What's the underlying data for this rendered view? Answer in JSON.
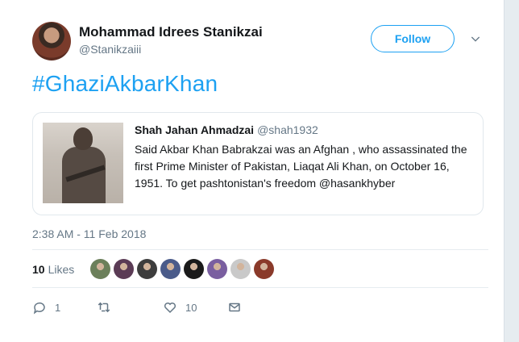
{
  "tweet": {
    "author_name": "Mohammad Idrees Stanikzai",
    "author_handle": "@Stanikzaiii",
    "follow_label": "Follow",
    "text": "#GhaziAkbarKhan",
    "timestamp": "2:38 AM - 11 Feb 2018"
  },
  "quote": {
    "author_name": "Shah Jahan Ahmadzai",
    "author_handle": "@shah1932",
    "text": "Said Akbar Khan Babrakzai was an Afghan , who assassinated the first Prime Minister of Pakistan, Liaqat Ali Khan, on October 16, 1951. To get pashtonistan's freedom @hasankhyber"
  },
  "likes": {
    "count": "10",
    "label": "Likes",
    "avatar_colors": [
      "#6b7f5a",
      "#5b3b55",
      "#3d3d3d",
      "#4a5b8a",
      "#1a1a1a",
      "#7a5fa0",
      "#c9c9c9",
      "#8a3a2a"
    ]
  },
  "actions": {
    "reply_count": "1",
    "retweet_count": "",
    "like_count": "10"
  },
  "colors": {
    "accent": "#1da1f2",
    "muted": "#657786"
  }
}
